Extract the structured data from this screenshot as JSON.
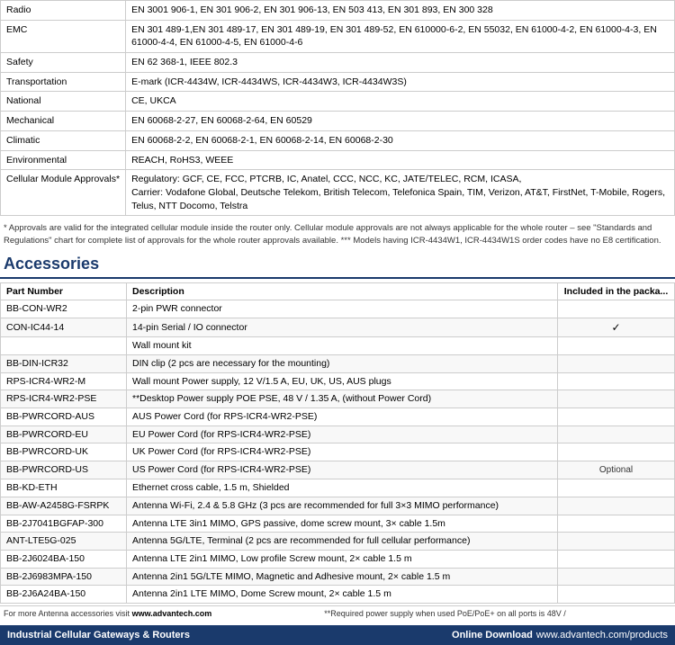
{
  "standards": [
    {
      "category": "Radio",
      "value": "EN 3001 906-1, EN 301 906-2, EN 301 906-13, EN 503 413, EN 301 893, EN 300 328"
    },
    {
      "category": "EMC",
      "value": "EN 301 489-1,EN 301 489-17, EN 301 489-19, EN 301 489-52, EN 610000-6-2, EN 55032, EN 61000-4-2, EN 61000-4-3, EN 61000-4-4, EN 61000-4-5, EN 61000-4-6"
    },
    {
      "category": "Safety",
      "value": "EN 62 368-1, IEEE 802.3"
    },
    {
      "category": "Transportation",
      "value": "E-mark (ICR-4434W, ICR-4434WS, ICR-4434W3, ICR-4434W3S)"
    },
    {
      "category": "National",
      "value": "CE, UKCA"
    },
    {
      "category": "Mechanical",
      "value": "EN 60068-2-27, EN 60068-2-64, EN 60529"
    },
    {
      "category": "Climatic",
      "value": "EN 60068-2-2, EN 60068-2-1, EN 60068-2-14, EN 60068-2-30"
    },
    {
      "category": "Environmental",
      "value": "REACH, RoHS3, WEEE"
    },
    {
      "category": "Cellular Module Approvals*",
      "value": "Regulatory: GCF, CE, FCC, PTCRB, IC, Anatel, CCC, NCC, KC, JATE/TELEC, RCM, ICASA,\nCarrier: Vodafone Global, Deutsche Telekom, British Telecom, Telefonica Spain, TIM, Verizon, AT&T, FirstNet, T-Mobile, Rogers, Telus, NTT Docomo, Telstra"
    }
  ],
  "footnotes": [
    "* Approvals are valid for the integrated cellular module inside the router only. Cellular module approvals are not always applicable for the whole router – see \"Standards and Regulations\" chart for complete list of approvals for the whole router approvals available. *** Models having ICR-4434W1, ICR-4434W1S order codes have no E8 certification."
  ],
  "accessories_title": "Accessories",
  "accessories_cols": {
    "part": "Part Number",
    "desc": "Description",
    "included": "Included in the packa..."
  },
  "accessories": [
    {
      "part": "BB-CON-WR2",
      "desc": "2-pin PWR connector",
      "included": ""
    },
    {
      "part": "CON-IC44-14",
      "desc": "14-pin Serial / IO connector",
      "included": "✓"
    },
    {
      "part": "",
      "desc": "Wall mount kit",
      "included": ""
    },
    {
      "part": "BB-DIN-ICR32",
      "desc": "DIN clip (2 pcs are necessary for the mounting)",
      "included": ""
    },
    {
      "part": "RPS-ICR4-WR2-M",
      "desc": "Wall mount Power supply, 12 V/1.5 A, EU, UK, US, AUS plugs",
      "included": ""
    },
    {
      "part": "RPS-ICR4-WR2-PSE",
      "desc": "**Desktop Power supply POE PSE, 48 V / 1.35 A, (without Power Cord)",
      "included": ""
    },
    {
      "part": "BB-PWRCORD-AUS",
      "desc": "AUS Power Cord (for RPS-ICR4-WR2-PSE)",
      "included": ""
    },
    {
      "part": "BB-PWRCORD-EU",
      "desc": "EU Power Cord (for RPS-ICR4-WR2-PSE)",
      "included": ""
    },
    {
      "part": "BB-PWRCORD-UK",
      "desc": "UK Power Cord (for RPS-ICR4-WR2-PSE)",
      "included": ""
    },
    {
      "part": "BB-PWRCORD-US",
      "desc": "US Power Cord (for RPS-ICR4-WR2-PSE)",
      "included": "Optional"
    },
    {
      "part": "BB-KD-ETH",
      "desc": "Ethernet cross cable, 1.5 m, Shielded",
      "included": ""
    },
    {
      "part": "BB-AW-A2458G-FSRPK",
      "desc": "Antenna Wi-Fi, 2.4 & 5.8 GHz (3 pcs are recommended for full 3×3 MIMO performance)",
      "included": ""
    },
    {
      "part": "BB-2J7041BGFAP-300",
      "desc": "Antenna LTE 3in1 MIMO, GPS passive, dome screw mount, 3× cable 1.5m",
      "included": ""
    },
    {
      "part": "ANT-LTE5G-025",
      "desc": "Antenna 5G/LTE, Terminal (2 pcs are recommended for full cellular performance)",
      "included": ""
    },
    {
      "part": "BB-2J6024BA-150",
      "desc": "Antenna LTE 2in1 MIMO, Low profile Screw mount, 2× cable 1.5 m",
      "included": ""
    },
    {
      "part": "BB-2J6983MPA-150",
      "desc": "Antenna 2in1 5G/LTE MIMO, Magnetic and Adhesive mount, 2× cable 1.5 m",
      "included": ""
    },
    {
      "part": "BB-2J6A24BA-150",
      "desc": "Antenna 2in1 LTE MIMO, Dome Screw mount, 2× cable 1.5 m",
      "included": ""
    }
  ],
  "bottom_note": "For more Antenna accessories visit www.advantech.com",
  "bottom_note2": "**Required power supply when used PoE/PoE+ on all ports is 48V /",
  "footer": {
    "company": "Industrial Cellular Gateways & Routers",
    "online_label": "Online Download",
    "url": "www.advantech.com/products"
  }
}
